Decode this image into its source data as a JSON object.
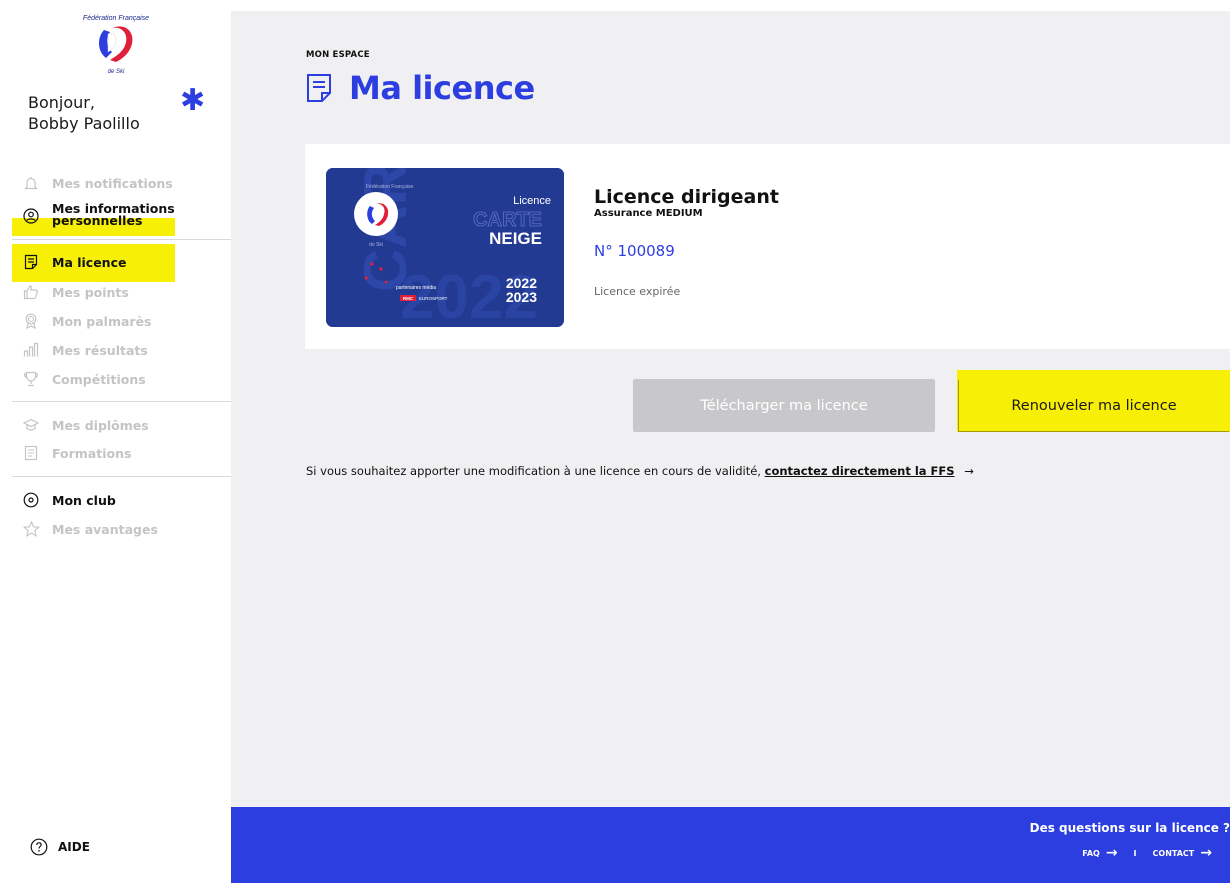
{
  "sidebar": {
    "logo_text": "Fédération Française de Ski",
    "greeting_line1": "Bonjour,",
    "greeting_line2": "Bobby Paolillo",
    "items": [
      {
        "label": "Mes notifications",
        "icon": "bell-icon"
      },
      {
        "label_line1": "Mes informations",
        "label_line2": "personnelles",
        "icon": "user-circle-icon"
      },
      {
        "label": "Ma licence",
        "icon": "document-icon"
      },
      {
        "label": "Mes points",
        "icon": "thumbs-up-icon"
      },
      {
        "label": "Mon palmarès",
        "icon": "medal-icon"
      },
      {
        "label": "Mes résultats",
        "icon": "bar-chart-icon"
      },
      {
        "label": "Compétitions",
        "icon": "trophy-icon"
      },
      {
        "label": "Mes diplômes",
        "icon": "graduation-cap-icon"
      },
      {
        "label": "Formations",
        "icon": "list-document-icon"
      },
      {
        "label": "Mon club",
        "icon": "location-pin-icon"
      },
      {
        "label": "Mes avantages",
        "icon": "star-icon"
      }
    ],
    "help_label": "AIDE"
  },
  "main": {
    "breadcrumb": "MON ESPACE",
    "title": "Ma licence",
    "card": {
      "title": "Licence dirigeant",
      "subtitle": "Assurance MEDIUM",
      "number": "N° 100089",
      "status": "Licence expirée",
      "image": {
        "label_licence": "Licence",
        "label_carte": "CARTE",
        "label_neige": "NEIGE",
        "label_year_top": "2022",
        "label_year_bottom": "2023",
        "partners": "partenaires média",
        "partner1": "RMC",
        "partner2": "EUROSPORT"
      }
    },
    "download_button": "Télécharger ma licence",
    "renew_button": "Renouveler ma licence",
    "note_text": "Si vous souhaitez apporter une modification à une licence en cours de validité, ",
    "note_link": "contactez directement la FFS",
    "note_arrow": "→"
  },
  "footer": {
    "question": "Des questions sur la licence ?",
    "faq": "FAQ",
    "separator": "I",
    "contact": "CONTACT",
    "arrow": "→"
  },
  "colors": {
    "accent_blue": "#2c3ee0",
    "highlight_yellow": "#f8ef07",
    "disabled_grey": "#c8c8cb",
    "card_navy": "#233a92"
  }
}
